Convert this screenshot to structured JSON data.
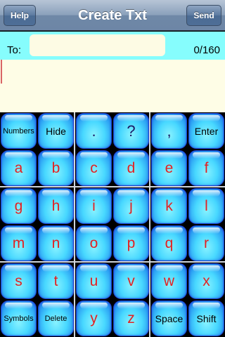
{
  "navbar": {
    "help_label": "Help",
    "title": "Create Txt",
    "send_label": "Send"
  },
  "compose": {
    "to_label": "To:",
    "to_value": "",
    "char_count": "0/160",
    "message_value": ""
  },
  "keyboard": {
    "rows": [
      [
        "Numbers",
        "Hide",
        ".",
        "?",
        ",",
        "Enter"
      ],
      [
        "a",
        "b",
        "c",
        "d",
        "e",
        "f"
      ],
      [
        "g",
        "h",
        "i",
        "j",
        "k",
        "l"
      ],
      [
        "m",
        "n",
        "o",
        "p",
        "q",
        "r"
      ],
      [
        "s",
        "t",
        "u",
        "v",
        "w",
        "x"
      ],
      [
        "Symbols",
        "Delete",
        "y",
        "z",
        "Space",
        "Shift"
      ]
    ]
  },
  "colors": {
    "key_letter": "#e32121",
    "to_row_background": "#86fdfd",
    "message_background": "#fefde6",
    "navbar": "#7a93b2"
  }
}
